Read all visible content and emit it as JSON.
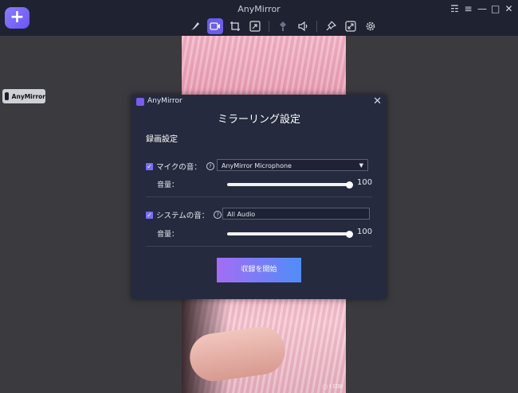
{
  "window": {
    "title": "AnyMirror",
    "add_label": "+",
    "controls": {
      "account": "☶",
      "menu": "≡",
      "minimize": "—",
      "maximize": "□",
      "close": "✕"
    }
  },
  "toolbar": {
    "items": [
      {
        "name": "brush-icon",
        "active": false
      },
      {
        "name": "record-icon",
        "active": true
      },
      {
        "name": "crop-icon",
        "active": false
      },
      {
        "name": "screenshot-icon",
        "active": false
      },
      {
        "name": "microphone-icon",
        "active": false
      },
      {
        "name": "speaker-icon",
        "active": false
      },
      {
        "name": "pin-icon",
        "active": false
      },
      {
        "name": "fullscreen-icon",
        "active": false
      },
      {
        "name": "settings-icon",
        "active": false
      }
    ],
    "accent_color": "#6a5cf0"
  },
  "side_tag": {
    "label": "AnyMirror"
  },
  "stage": {
    "watermark": "○ I ☷☒"
  },
  "dialog": {
    "app_name": "AnyMirror",
    "close_label": "✕",
    "title": "ミラーリング設定",
    "section_title": "録画設定",
    "mic": {
      "checked": true,
      "label": "マイクの音：",
      "help": "?",
      "device": "AnyMirror Microphone",
      "volume_label": "音量：",
      "volume": 100
    },
    "system": {
      "checked": true,
      "label": "システムの音：",
      "help": "?",
      "source": "All Audio",
      "volume_label": "音量：",
      "volume": 100
    },
    "start_button": "収録を開始"
  }
}
